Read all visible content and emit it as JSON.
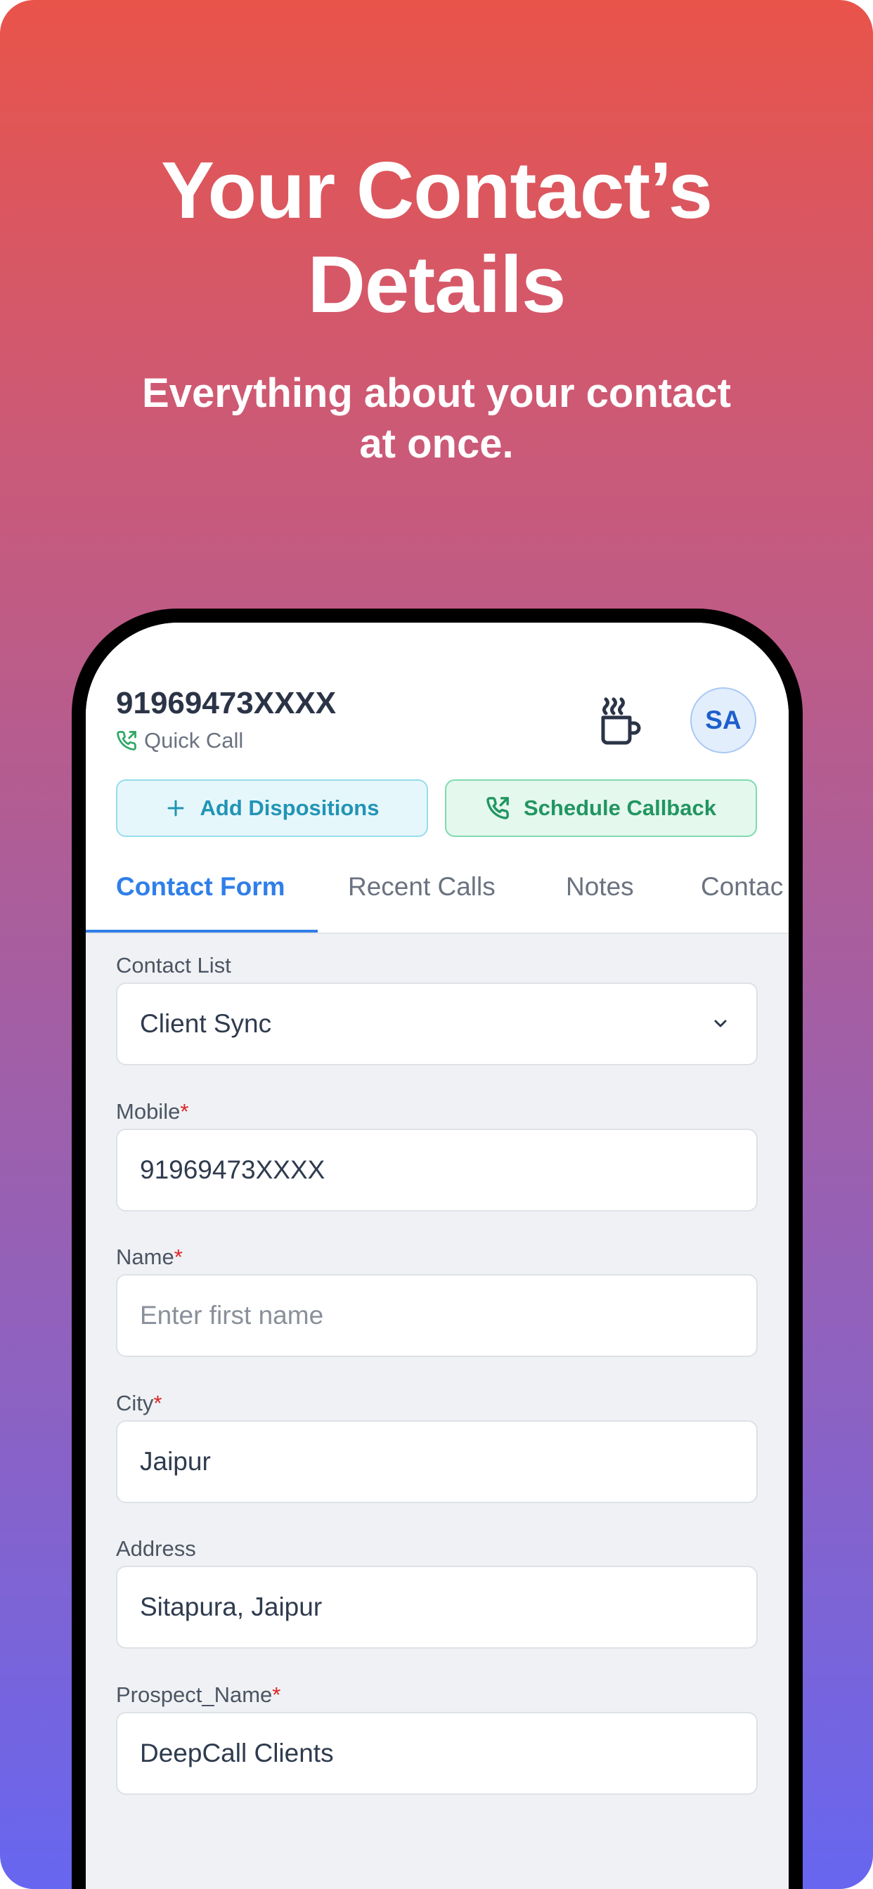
{
  "hero": {
    "title_line1": "Your Contact’s",
    "title_line2": "Details",
    "subtitle_line1": "Everything about your contact",
    "subtitle_line2": "at once."
  },
  "header": {
    "phone_number": "91969473XXXX",
    "call_type": "Quick Call",
    "avatar_initials": "SA"
  },
  "actions": {
    "add_dispositions": "Add Dispositions",
    "schedule_callback": "Schedule Callback"
  },
  "tabs": [
    {
      "label": "Contact Form",
      "active": true
    },
    {
      "label": "Recent Calls",
      "active": false
    },
    {
      "label": "Notes",
      "active": false
    },
    {
      "label": "Contac",
      "active": false
    }
  ],
  "form": {
    "contact_list": {
      "label": "Contact List",
      "value": "Client Sync"
    },
    "mobile": {
      "label": "Mobile",
      "required_mark": "*",
      "value": "91969473XXXX"
    },
    "name": {
      "label": "Name",
      "required_mark": "*",
      "placeholder": "Enter first name"
    },
    "city": {
      "label": "City",
      "required_mark": "*",
      "value": "Jaipur"
    },
    "address": {
      "label": "Address",
      "value": "Sitapura, Jaipur"
    },
    "prospect_name": {
      "label": "Prospect_Name",
      "required_mark": "*",
      "value": "DeepCall Clients"
    }
  },
  "icons": {
    "quick_call": "phone-outgoing-icon",
    "break": "coffee-mug-icon",
    "add": "plus-icon",
    "callback": "phone-callback-icon",
    "dropdown": "chevron-down-icon"
  },
  "colors": {
    "gradient_top": "#E9544A",
    "gradient_bottom": "#6766F0",
    "primary": "#2F7FE8",
    "disposition_text": "#2294B5",
    "callback_text": "#229560",
    "required": "#DC2626"
  }
}
